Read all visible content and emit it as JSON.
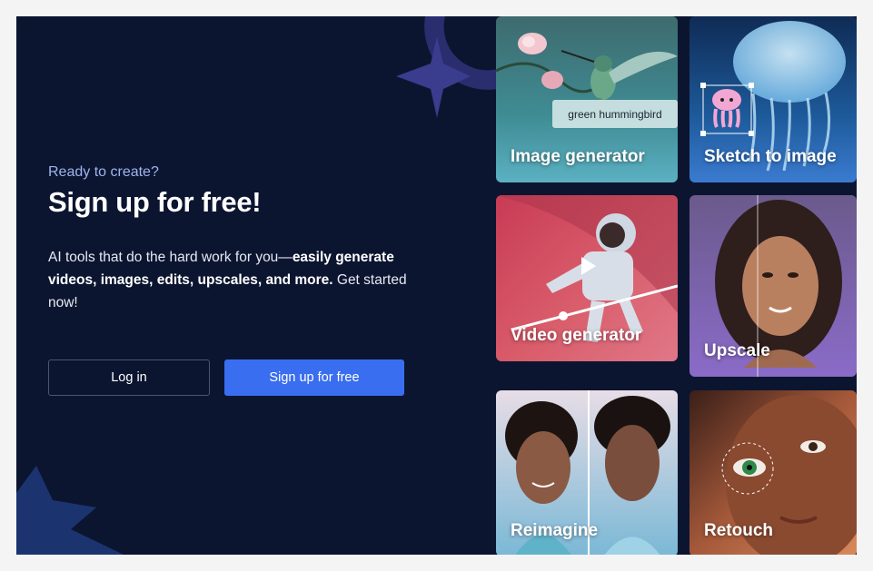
{
  "signup": {
    "eyebrow": "Ready to create?",
    "headline": "Sign up for free!",
    "description_intro": "AI tools that do the hard work for you—",
    "description_bold": "easily generate videos, images, edits, upscales, and more.",
    "description_outro": " Get started now!",
    "login_label": "Log in",
    "signup_label": "Sign up for free"
  },
  "tools": [
    {
      "label": "Image generator",
      "tag": "green hummingbird"
    },
    {
      "label": "Sketch to image"
    },
    {
      "label": "Video generator"
    },
    {
      "label": "Upscale"
    },
    {
      "label": "Reimagine"
    },
    {
      "label": "Retouch"
    }
  ],
  "colors": {
    "background": "#0c1530",
    "accent": "#3a6ef0",
    "eyebrow": "#9fb4ee"
  }
}
